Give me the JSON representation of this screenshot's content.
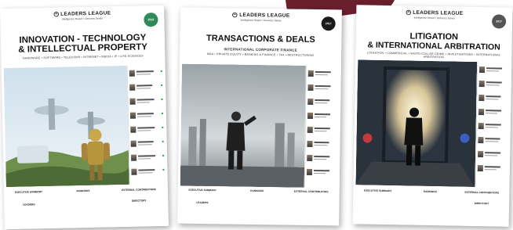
{
  "logo": {
    "brand": "LEADERS LEAGUE",
    "tagline": "Intelligence Report • Directory Series"
  },
  "covers": [
    {
      "title_line1": "INNOVATION - TECHNOLOGY",
      "title_line2": "& INTELLECTUAL PROPERTY",
      "subtitle": "HARDWARE • SOFTWARE • TELECOMS • INTERNET • MEDIA • IP • LIFE SCIENCES",
      "badge": "2016",
      "badge_color": "#2e8b57",
      "footer": {
        "col1_head": "EXECUTIVE SUMMARY",
        "col1_sub": "LEADERS",
        "col2_head": "RANKINGS",
        "col3_head": "EXTERNAL CONTRIBUTORS",
        "col3_sub": "DIRECTORY"
      }
    },
    {
      "title_line1": "TRANSACTIONS & DEALS",
      "subtitle": "INTERNATIONAL CORPORATE FINANCE",
      "subtitle2": "M&A • PRIVATE EQUITY • BANKING & FINANCE • TAX • RESTRUCTURING",
      "badge": "2017",
      "badge_color": "#1a1a1a",
      "footer": {
        "col1_head": "EXECUTIVE SUMMARY",
        "col1_sub": "LEADERS",
        "col2_head": "RANKINGS",
        "col3_head": "EXTERNAL CONTRIBUTORS"
      }
    },
    {
      "title_line1": "LITIGATION",
      "title_line2": "& INTERNATIONAL ARBITRATION",
      "subtitle": "LITIGATION • COMMERCIAL • WHITE-COLLAR CRIME • INVESTIGATIONS • INTERNATIONAL ARBITRATION",
      "badge": "2017",
      "badge_color": "#555555",
      "footer": {
        "col1_head": "EXECUTIVE SUMMARY",
        "col2_head": "RANKINGS",
        "col3_head": "EXTERNAL CONTRIBUTORS",
        "col3_sub": "DIRECTORY"
      }
    }
  ]
}
